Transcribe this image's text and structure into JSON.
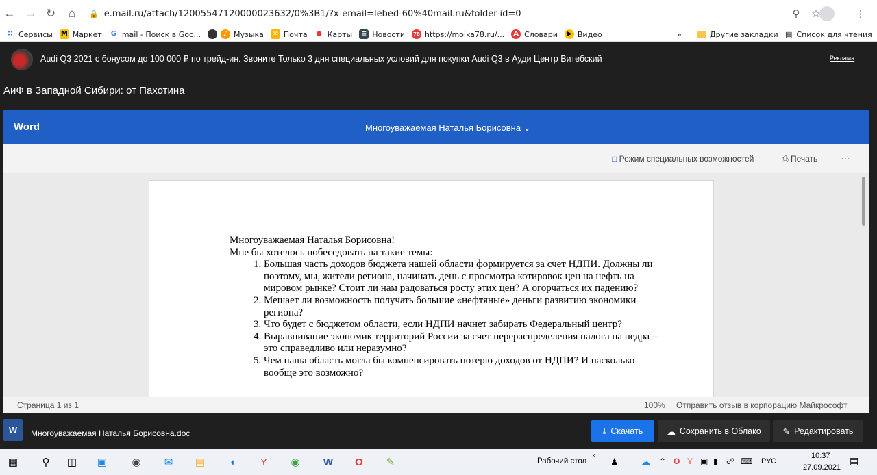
{
  "browser": {
    "url": "e.mail.ru/attach/12005547120000023632/0%3B1/?x-email=lebed-60%40mail.ru&folder-id=0",
    "bookmarks": [
      "Сервисы",
      "Маркет",
      "mail - Поиск в Goo...",
      "Музыка",
      "Почта",
      "Карты",
      "Новости",
      "https://moika78.ru/...",
      "Словари",
      "Видео"
    ],
    "bookmarks_more": "»",
    "other_bookmarks": "Другие закладки",
    "reading_list": "Список для чтения"
  },
  "ad": {
    "text": "Audi Q3 2021 с бонусом до 100 000 ₽ по трейд-ин. Звоните  Только 3 дня специальных условий для покупки Audi Q3 в Ауди Центр Витебский",
    "label": "Реклама"
  },
  "subtitle": "АиФ в Западной Сибири: от Пахотина",
  "word": {
    "brand": "Word",
    "doc_title": "Многоуважаемая Наталья Борисовна",
    "accessibility": "Режим специальных возможностей",
    "print": "Печать",
    "more": "···"
  },
  "document": {
    "greeting": "Многоуважаемая Наталья Борисовна!",
    "intro": "Мне бы хотелось побеседовать на такие темы:",
    "items": [
      "Большая часть доходов бюджета нашей области формируется за счет НДПИ. Должны ли поэтому, мы, жители региона, начинать день с просмотра котировок цен на нефть на мировом рынке? Стоит ли нам  радоваться росту этих цен? А огорчаться их падению?",
      "Мешает ли возможность получать большие «нефтяные» деньги развитию экономики региона?",
      "Что будет с бюджетом области, если НДПИ начнет забирать Федеральный центр?",
      "Выравнивание экономик территорий России за счет перераспределения налога на недра – это справедливо или неразумно?",
      "Чем наша область могла бы компенсировать потерю доходов от НДПИ? И насколько вообще это возможно?"
    ]
  },
  "status": {
    "page": "Страница 1 из 1",
    "zoom": "100%",
    "feedback": "Отправить отзыв в корпорацию Майкрософт"
  },
  "download": {
    "filename": "Многоуважаемая Наталья Борисовна.doc",
    "download": "Скачать",
    "cloud": "Сохранить в Облако",
    "edit": "Редактировать"
  },
  "taskbar": {
    "desktop": "Рабочий стол",
    "lang": "РУС",
    "time": "10:37",
    "date": "27.09.2021"
  },
  "colors": {
    "word_blue": "#1f5fc6",
    "download_blue": "#1a73e8"
  }
}
